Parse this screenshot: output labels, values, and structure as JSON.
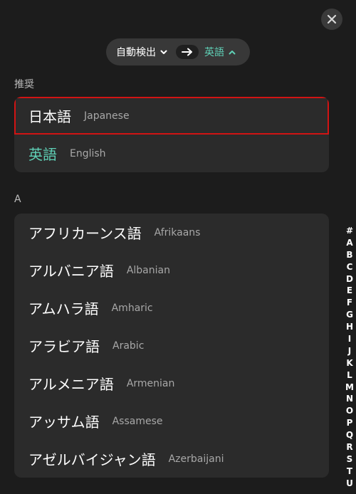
{
  "close": {
    "icon": "close-icon"
  },
  "selector": {
    "source_label": "自動検出",
    "target_label": "英語",
    "swap_icon": "arrow-right-icon",
    "accent_color": "#5fd0b6"
  },
  "recommended": {
    "section_label": "推奨",
    "items": [
      {
        "native": "日本語",
        "english": "Japanese"
      },
      {
        "native": "英語",
        "english": "English"
      }
    ]
  },
  "section_a": {
    "section_label": "A",
    "items": [
      {
        "native": "アフリカーンス語",
        "english": "Afrikaans"
      },
      {
        "native": "アルバニア語",
        "english": "Albanian"
      },
      {
        "native": "アムハラ語",
        "english": "Amharic"
      },
      {
        "native": "アラビア語",
        "english": "Arabic"
      },
      {
        "native": "アルメニア語",
        "english": "Armenian"
      },
      {
        "native": "アッサム語",
        "english": "Assamese"
      },
      {
        "native": "アゼルバイジャン語",
        "english": "Azerbaijani"
      }
    ]
  },
  "index": [
    "#",
    "A",
    "B",
    "C",
    "D",
    "E",
    "F",
    "G",
    "H",
    "I",
    "J",
    "K",
    "L",
    "M",
    "N",
    "O",
    "P",
    "Q",
    "R",
    "S",
    "T",
    "U"
  ]
}
